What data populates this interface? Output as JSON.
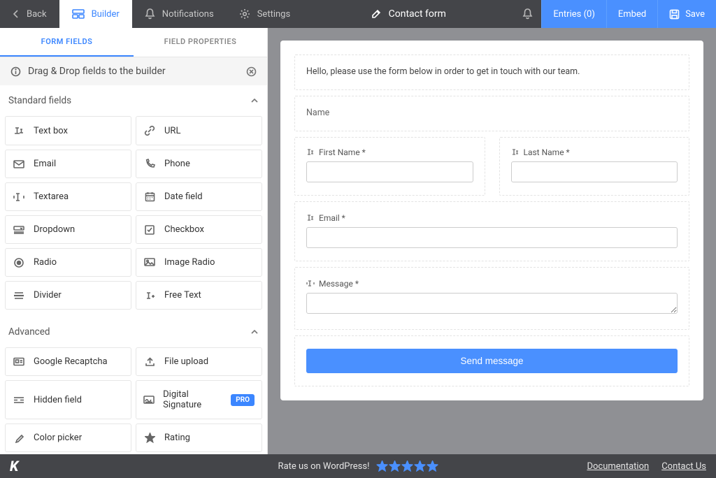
{
  "topbar": {
    "back": "Back",
    "builder": "Builder",
    "notifications": "Notifications",
    "settings": "Settings",
    "title": "Contact form",
    "entries": "Entries (0)",
    "embed": "Embed",
    "save": "Save"
  },
  "tabs": {
    "form_fields": "FORM FIELDS",
    "field_properties": "FIELD PROPERTIES"
  },
  "hint": "Drag & Drop fields to the builder",
  "sections": {
    "standard": "Standard fields",
    "advanced": "Advanced"
  },
  "standard_fields": [
    {
      "id": "textbox",
      "label": "Text box"
    },
    {
      "id": "url",
      "label": "URL"
    },
    {
      "id": "email",
      "label": "Email"
    },
    {
      "id": "phone",
      "label": "Phone"
    },
    {
      "id": "textarea",
      "label": "Textarea"
    },
    {
      "id": "date",
      "label": "Date field"
    },
    {
      "id": "dropdown",
      "label": "Dropdown"
    },
    {
      "id": "checkbox",
      "label": "Checkbox"
    },
    {
      "id": "radio",
      "label": "Radio"
    },
    {
      "id": "imgradio",
      "label": "Image Radio"
    },
    {
      "id": "divider",
      "label": "Divider"
    },
    {
      "id": "freetext",
      "label": "Free Text"
    }
  ],
  "advanced_fields": [
    {
      "id": "recaptcha",
      "label": "Google Recaptcha"
    },
    {
      "id": "upload",
      "label": "File upload"
    },
    {
      "id": "hidden",
      "label": "Hidden field"
    },
    {
      "id": "signature",
      "label": "Digital Signature",
      "pro": "PRO"
    },
    {
      "id": "colorpicker",
      "label": "Color picker"
    },
    {
      "id": "rating",
      "label": "Rating"
    }
  ],
  "form": {
    "intro": "Hello, please use the form below in order to get in touch with our team.",
    "name_label": "Name",
    "first_name": "First Name *",
    "last_name": "Last Name *",
    "email": "Email *",
    "message": "Message *",
    "submit": "Send message"
  },
  "footer": {
    "rate": "Rate us on WordPress!",
    "documentation": "Documentation",
    "contact": "Contact Us"
  }
}
